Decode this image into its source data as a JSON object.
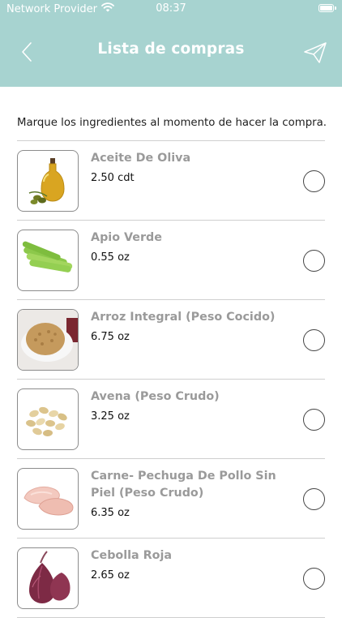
{
  "status_bar": {
    "carrier": "Network Provider",
    "time": "08:37"
  },
  "header": {
    "title": "Lista de compras"
  },
  "instruction": "Marque los ingredientes al momento de hacer la compra.",
  "items": [
    {
      "name": "Aceite De Oliva",
      "qty": "2.50 cdt"
    },
    {
      "name": "Apio Verde",
      "qty": "0.55 oz"
    },
    {
      "name": "Arroz Integral (Peso Cocido)",
      "qty": "6.75 oz"
    },
    {
      "name": "Avena (Peso Crudo)",
      "qty": "3.25 oz"
    },
    {
      "name": "Carne- Pechuga De Pollo Sin Piel (Peso Crudo)",
      "qty": "6.35 oz"
    },
    {
      "name": "Cebolla Roja",
      "qty": "2.65 oz"
    }
  ],
  "colors": {
    "header_bg": "#a7d3d0",
    "item_name": "#9a9a9a",
    "divider": "#cfcfcf"
  },
  "icons": {
    "back": "chevron-left-icon",
    "send": "paper-plane-icon",
    "check": "radio-circle-icon"
  }
}
